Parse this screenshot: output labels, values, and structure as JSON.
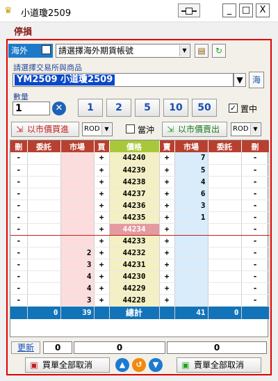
{
  "window": {
    "title": "小道瓊2509",
    "minimize": "_",
    "maximize": "□",
    "close": "X"
  },
  "menu": {
    "stop_loss": "停損"
  },
  "account": {
    "overseas_label": "海外",
    "select_value": "請選擇海外期貨帳號"
  },
  "product": {
    "group_label": "請選擇交易所與商品",
    "value": "YM2509 小道瓊2509",
    "overseas_button": "海"
  },
  "quantity": {
    "group_label": "數量",
    "value": "1",
    "presets": [
      "1",
      "2",
      "5",
      "10",
      "50"
    ],
    "pin_label": "置中"
  },
  "order_bar": {
    "market_buy": "以市價買進",
    "buy_rod": "ROD",
    "offset_label": "當沖",
    "market_sell": "以市價賣出",
    "sell_rod": "ROD"
  },
  "ladder": {
    "headers": [
      "刪",
      "委託",
      "市場",
      "買",
      "價格",
      "賣",
      "市場",
      "委託",
      "刪"
    ],
    "rows": [
      {
        "del_b": "-",
        "order_b": "",
        "mkt_b": "",
        "buy": "+",
        "price": "44240",
        "sell": "+",
        "mkt_s": "7",
        "order_s": "",
        "del_s": "-"
      },
      {
        "del_b": "-",
        "order_b": "",
        "mkt_b": "",
        "buy": "+",
        "price": "44239",
        "sell": "+",
        "mkt_s": "5",
        "order_s": "",
        "del_s": "-"
      },
      {
        "del_b": "-",
        "order_b": "",
        "mkt_b": "",
        "buy": "+",
        "price": "44238",
        "sell": "+",
        "mkt_s": "4",
        "order_s": "",
        "del_s": "-"
      },
      {
        "del_b": "-",
        "order_b": "",
        "mkt_b": "",
        "buy": "+",
        "price": "44237",
        "sell": "+",
        "mkt_s": "6",
        "order_s": "",
        "del_s": "-"
      },
      {
        "del_b": "-",
        "order_b": "",
        "mkt_b": "",
        "buy": "+",
        "price": "44236",
        "sell": "+",
        "mkt_s": "3",
        "order_s": "",
        "del_s": "-"
      },
      {
        "del_b": "-",
        "order_b": "",
        "mkt_b": "",
        "buy": "+",
        "price": "44235",
        "sell": "+",
        "mkt_s": "1",
        "order_s": "",
        "del_s": "-"
      },
      {
        "del_b": "-",
        "order_b": "",
        "mkt_b": "",
        "buy": "+",
        "price": "44234",
        "sell": "+",
        "mkt_s": "",
        "order_s": "",
        "del_s": "-"
      },
      {
        "del_b": "-",
        "order_b": "",
        "mkt_b": "",
        "buy": "+",
        "price": "44233",
        "sell": "+",
        "mkt_s": "",
        "order_s": "",
        "del_s": "-"
      },
      {
        "del_b": "-",
        "order_b": "",
        "mkt_b": "2",
        "buy": "+",
        "price": "44232",
        "sell": "+",
        "mkt_s": "",
        "order_s": "",
        "del_s": "-"
      },
      {
        "del_b": "-",
        "order_b": "",
        "mkt_b": "3",
        "buy": "+",
        "price": "44231",
        "sell": "+",
        "mkt_s": "",
        "order_s": "",
        "del_s": "-"
      },
      {
        "del_b": "-",
        "order_b": "",
        "mkt_b": "4",
        "buy": "+",
        "price": "44230",
        "sell": "+",
        "mkt_s": "",
        "order_s": "",
        "del_s": "-"
      },
      {
        "del_b": "-",
        "order_b": "",
        "mkt_b": "4",
        "buy": "+",
        "price": "44229",
        "sell": "+",
        "mkt_s": "",
        "order_s": "",
        "del_s": "-"
      },
      {
        "del_b": "-",
        "order_b": "",
        "mkt_b": "3",
        "buy": "+",
        "price": "44228",
        "sell": "+",
        "mkt_s": "",
        "order_s": "",
        "del_s": "-"
      }
    ],
    "last_price_row": 6,
    "totals": {
      "order_b": "0",
      "mkt_b": "39",
      "label": "總計",
      "mkt_s": "41",
      "order_s": "0"
    }
  },
  "footer": {
    "refresh": "更新",
    "box1": "0",
    "box2": "0",
    "box3": "0"
  },
  "bottom": {
    "cancel_all_buy": "買單全部取消",
    "cancel_all_sell": "賣單全部取消"
  },
  "colors": {
    "frame_border": "#e00000",
    "header_red": "#b84030",
    "header_green": "#a8c83c",
    "total_blue": "#1273b8",
    "last_price_pink": "#e49aa0"
  }
}
